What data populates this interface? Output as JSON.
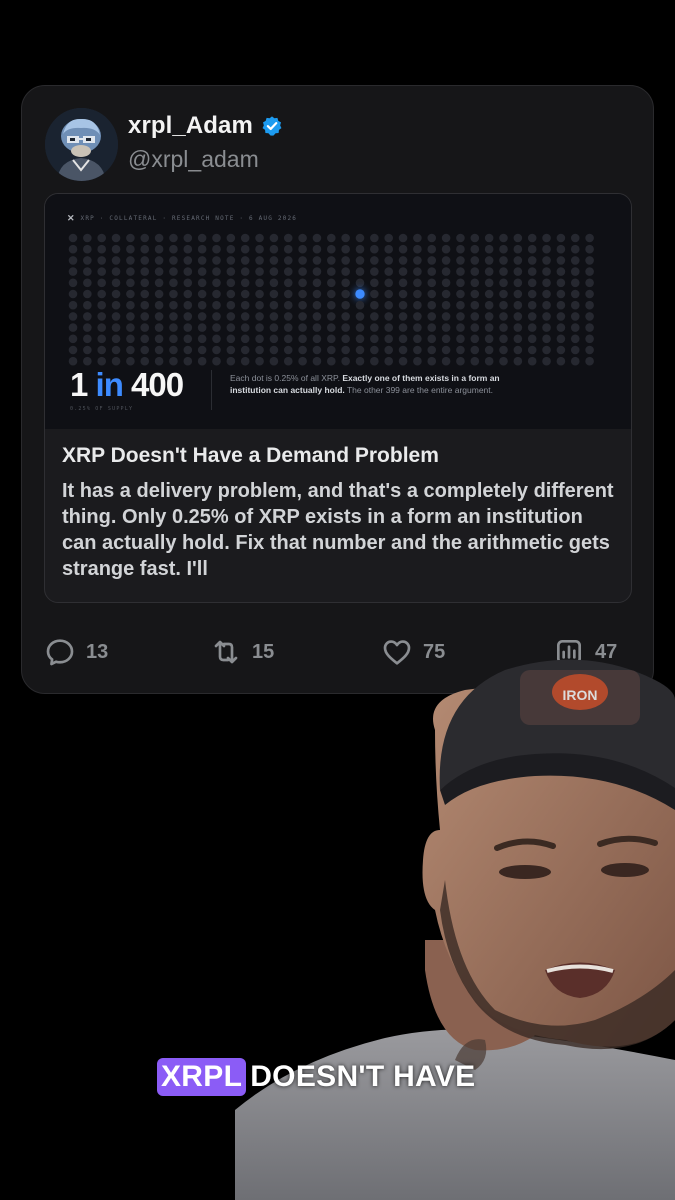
{
  "post": {
    "display_name": "xrpl_Adam",
    "handle": "@xrpl_adam",
    "verified": true,
    "avatar_icon": "pixel-art-avatar"
  },
  "link_card": {
    "preview": {
      "brand_mark": "✕",
      "meta": "XRP · COLLATERAL · RESEARCH NOTE · 6 AUG 2026",
      "stat_number": "1",
      "stat_in": "in",
      "stat_total": "400",
      "stat_sub": "0.25% OF SUPPLY",
      "desc_plain": "Each dot is 0.25% of all XRP.",
      "desc_emphasis": "Exactly one of them exists in a form an institution can actually hold.",
      "desc_tail": "The other 399 are the entire argument.",
      "dot_grid": {
        "rows": 12,
        "cols": 37,
        "highlighted_row": 5,
        "highlighted_col": 20,
        "dot_color": "#262830",
        "highlight_color": "#3d8bff"
      }
    },
    "headline": "XRP Doesn't Have a Demand Problem",
    "snippet": "It has a delivery problem, and that's a completely different thing. Only 0.25% of XRP exists in a form an institution can actually hold. Fix that number and the arithmetic gets strange fast. I'll"
  },
  "actions": {
    "replies": "13",
    "reposts": "15",
    "likes": "75",
    "views": "47"
  },
  "caption": {
    "highlight": "XRPL",
    "rest": "DOESN'T HAVE"
  },
  "colors": {
    "accent_blue": "#3d8bff",
    "verified_blue": "#1d9bf0",
    "caption_highlight": "#8b5cf6"
  }
}
